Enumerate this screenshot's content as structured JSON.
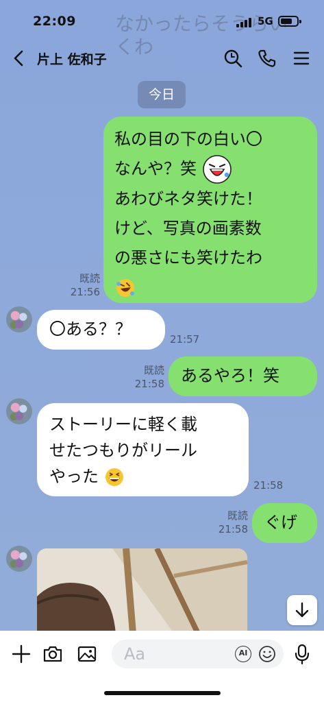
{
  "status_bar": {
    "time": "22:09",
    "network": "5G",
    "ghost_notification": "なかったらそうらいくわ"
  },
  "header": {
    "title": "片上 佐和子",
    "icons": [
      "back-icon",
      "search-icon",
      "phone-icon",
      "menu-icon"
    ]
  },
  "date_label": "今日",
  "messages": [
    {
      "side": "sent",
      "lines": [
        "私の目の下の白い〇",
        "なんや？笑",
        "あわびネタ笑けた！",
        "けど、写真の画素数",
        "の悪さにも笑けたわ"
      ],
      "read_label": "既読",
      "time": "21:56"
    },
    {
      "side": "received",
      "text": "〇ある？？",
      "time": "21:57"
    },
    {
      "side": "sent",
      "text": "あるやろ！笑",
      "read_label": "既読",
      "time": "21:58"
    },
    {
      "side": "received",
      "lines": [
        "ストーリーに軽く載",
        "せたつもりがリール",
        "やった"
      ],
      "time": "21:58"
    },
    {
      "side": "sent",
      "text": "ぐげ",
      "read_label": "既読",
      "time": "21:58"
    }
  ],
  "input": {
    "placeholder": "Aa",
    "ai_label": "AI"
  },
  "colors": {
    "background": "#8fa9d9",
    "sent_bubble": "#86e06f",
    "received_bubble": "#ffffff",
    "date_chip": "#6e82aa"
  }
}
